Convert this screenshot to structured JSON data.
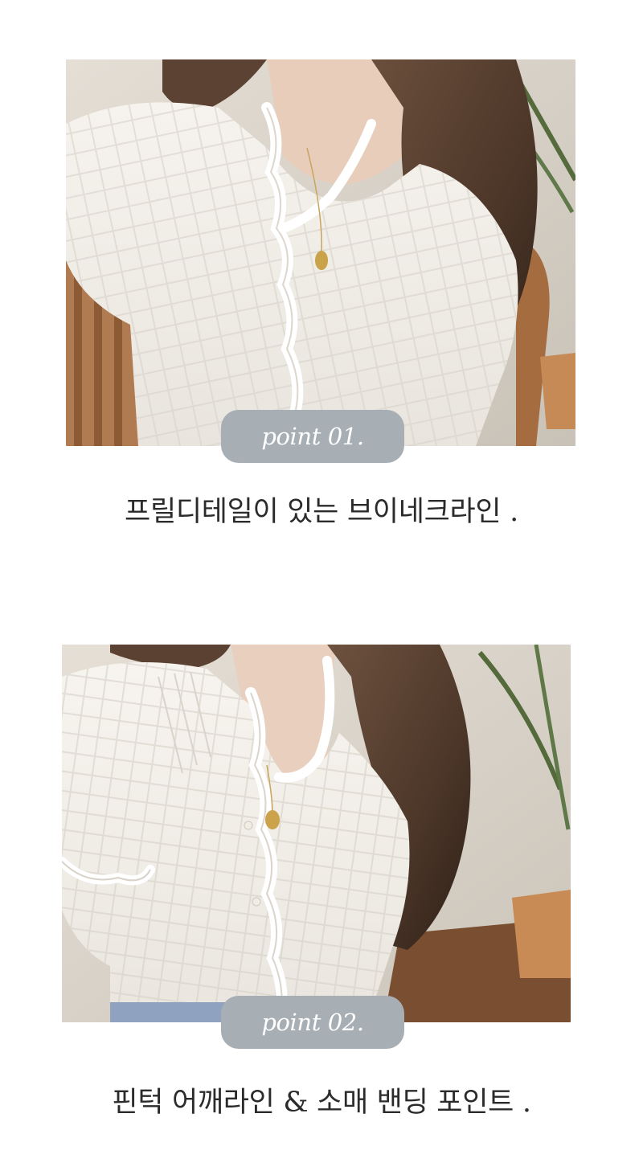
{
  "section1": {
    "badge": "point 01.",
    "caption": "프릴디테일이 있는 브이네크라인 ."
  },
  "section2": {
    "badge": "point 02.",
    "caption": "핀턱 어깨라인 & 소매 밴딩 포인트 ."
  },
  "colors": {
    "badge_bg": "#a7aeb4",
    "badge_text": "#ffffff",
    "caption_text": "#2b2b2b",
    "blouse": "#f3f0ea",
    "hair": "#5b4334",
    "wall": "#d9d3ca",
    "wood": "#9a6a45"
  }
}
